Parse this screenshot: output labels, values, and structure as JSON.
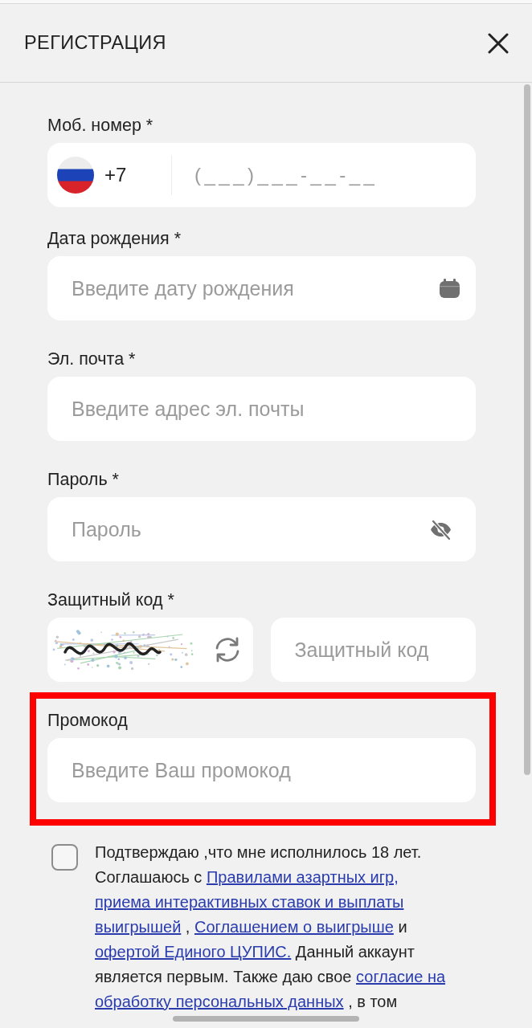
{
  "header": {
    "title": "РЕГИСТРАЦИЯ"
  },
  "fields": [
    {
      "kind": "phone",
      "label": "Моб. номер *",
      "country_code": "+7",
      "placeholder": "(___)___-__-__",
      "highlighted": false
    },
    {
      "kind": "date",
      "label": "Дата рождения *",
      "placeholder": "Введите дату рождения",
      "highlighted": false
    },
    {
      "kind": "email",
      "label": "Эл. почта *",
      "placeholder": "Введите адрес эл. почты",
      "highlighted": false
    },
    {
      "kind": "password",
      "label": "Пароль *",
      "placeholder": "Пароль",
      "highlighted": false
    },
    {
      "kind": "captcha",
      "label": "Защитный код *",
      "placeholder": "Защитный код",
      "highlighted": false
    },
    {
      "kind": "promo",
      "label": "Промокод",
      "placeholder": "Введите Ваш промокод",
      "highlighted": true
    }
  ],
  "consent": {
    "checked": false,
    "segments": [
      {
        "kind": "text",
        "text": "Подтверждаю ,что мне исполнилось 18 лет. Соглашаюсь с "
      },
      {
        "kind": "link",
        "text": "Правилами азартных игр,"
      },
      {
        "kind": "link",
        "text": "приема интерактивных ставок и выплаты"
      },
      {
        "kind": "link",
        "text": "выигрышей"
      },
      {
        "kind": "text",
        "text": " , "
      },
      {
        "kind": "link",
        "text": "Соглашением о выигрыше"
      },
      {
        "kind": "text",
        "text": " и "
      },
      {
        "kind": "link",
        "text": "офертой Единого ЦУПИС."
      },
      {
        "kind": "text",
        "text": " Данный аккаунт является первым. Также даю свое "
      },
      {
        "kind": "link",
        "text": "согласие на"
      },
      {
        "kind": "link",
        "text": "обработку персональных данных"
      },
      {
        "kind": "text",
        "text": " , в том"
      }
    ]
  }
}
